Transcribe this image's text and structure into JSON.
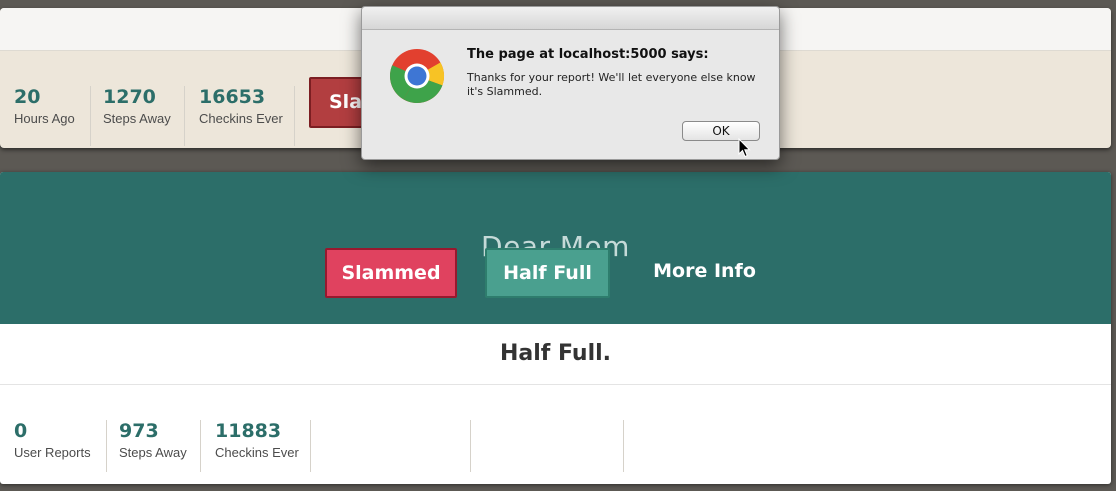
{
  "top_card": {
    "stats": [
      {
        "value": "20",
        "label": "Hours Ago"
      },
      {
        "value": "1270",
        "label": "Steps Away"
      },
      {
        "value": "16653",
        "label": "Checkins Ever"
      }
    ],
    "slammed_label": "Slammed"
  },
  "place_card": {
    "name": "Dear Mom",
    "status": "Half Full.",
    "stats": [
      {
        "value": "0",
        "label": "User Reports"
      },
      {
        "value": "973",
        "label": "Steps Away"
      },
      {
        "value": "11883",
        "label": "Checkins Ever"
      }
    ],
    "buttons": {
      "slammed": "Slammed",
      "half_full": "Half Full",
      "more_info": "More Info"
    }
  },
  "dialog": {
    "title": "The page at localhost:5000 says:",
    "message": "Thanks for your report! We'll let everyone else know it's Slammed.",
    "ok_label": "OK",
    "icon": "chrome-logo-icon"
  },
  "colors": {
    "teal": "#2c6e69",
    "slammed_red": "#e0425f",
    "half_full_green": "#4aa08f",
    "cream": "#ede6da"
  }
}
